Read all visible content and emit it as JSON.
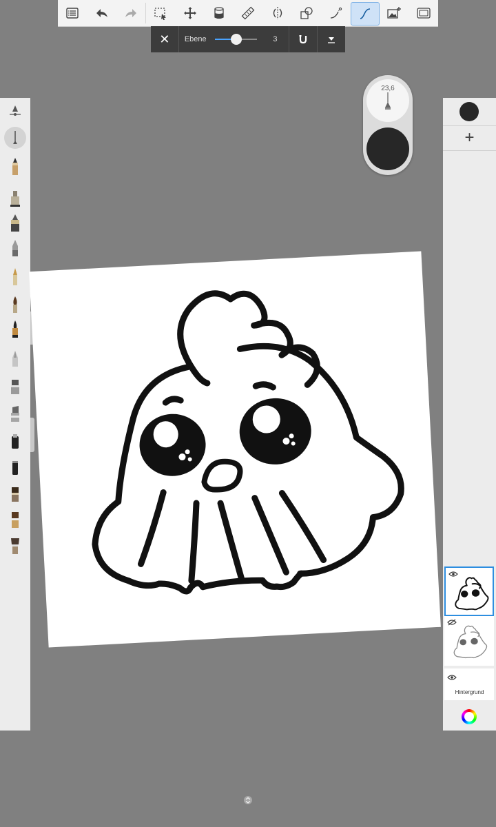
{
  "toolbar": {
    "items": [
      {
        "name": "lagoon-menu-icon"
      },
      {
        "name": "undo-icon"
      },
      {
        "name": "redo-icon"
      },
      {
        "name": "selection-icon"
      },
      {
        "name": "transform-icon"
      },
      {
        "name": "fill-bucket-icon"
      },
      {
        "name": "ruler-icon"
      },
      {
        "name": "symmetry-icon"
      },
      {
        "name": "shape-icon"
      },
      {
        "name": "perspective-icon"
      },
      {
        "name": "steady-stroke-icon",
        "active": true
      },
      {
        "name": "add-image-icon"
      },
      {
        "name": "fullscreen-icon"
      }
    ]
  },
  "sub_toolbar": {
    "label": "Ebene",
    "value": "3",
    "slider_fraction": 0.5
  },
  "brush_puck": {
    "size": "23,6"
  },
  "colors": {
    "current": "#272727",
    "accent": "#2d8ee0"
  },
  "layers": {
    "background_label": "Hintergrund"
  },
  "brushes": [
    {
      "name": "brush-settings-icon"
    },
    {
      "name": "pen-icon",
      "selected": true
    },
    {
      "name": "pencil-icon"
    },
    {
      "name": "marker-icon"
    },
    {
      "name": "ink-pen-icon"
    },
    {
      "name": "airbrush-icon"
    },
    {
      "name": "fountain-pen-icon"
    },
    {
      "name": "paintbrush-icon"
    },
    {
      "name": "brush-pen-icon"
    },
    {
      "name": "chalk-icon"
    },
    {
      "name": "marker-wide-icon"
    },
    {
      "name": "marker-chisel-icon"
    },
    {
      "name": "eraser-pen-icon"
    },
    {
      "name": "smudge-icon"
    },
    {
      "name": "flat-brush-icon"
    },
    {
      "name": "oil-brush-icon"
    },
    {
      "name": "fan-brush-icon"
    }
  ]
}
